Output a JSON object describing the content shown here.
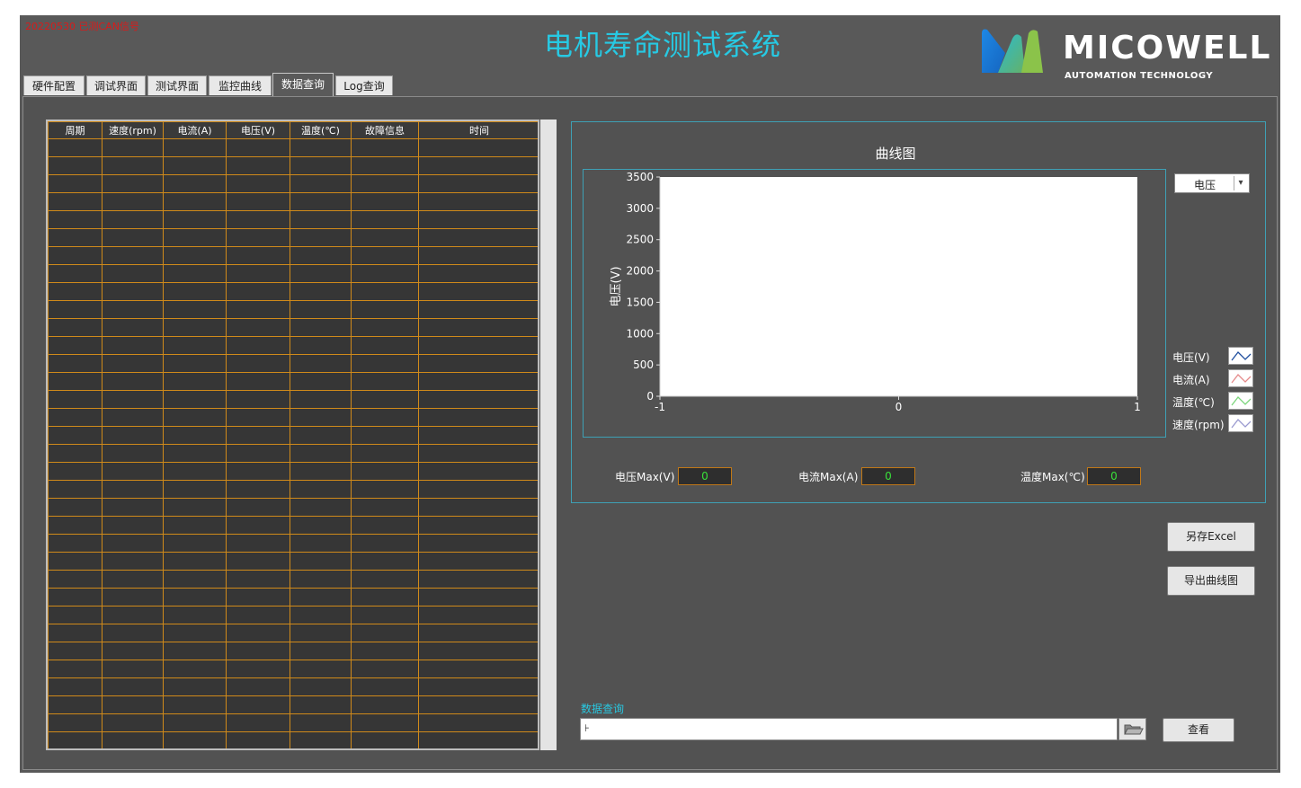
{
  "header": {
    "note": "20220530 已测CAN信号",
    "title": "电机寿命测试系统",
    "logo": {
      "name": "MICOWELL",
      "subtitle": "AUTOMATION TECHNOLOGY"
    }
  },
  "tabs": [
    {
      "label": "硬件配置",
      "active": false
    },
    {
      "label": "调试界面",
      "active": false
    },
    {
      "label": "测试界面",
      "active": false
    },
    {
      "label": "监控曲线",
      "active": false
    },
    {
      "label": "数据查询",
      "active": true
    },
    {
      "label": "Log查询",
      "active": false
    }
  ],
  "table": {
    "columns": [
      "周期",
      "速度(rpm)",
      "电流(A)",
      "电压(V)",
      "温度(℃)",
      "故障信息",
      "时间"
    ],
    "empty_rows": 34
  },
  "chart_data": {
    "type": "line",
    "title": "曲线图",
    "ylabel": "电压(V)",
    "xlim": [
      -1,
      1
    ],
    "ylim": [
      0,
      3500
    ],
    "x_ticks": [
      "-1",
      "0",
      "1"
    ],
    "y_ticks": [
      "3500",
      "3000",
      "2500",
      "2000",
      "1500",
      "1000",
      "500",
      "0"
    ],
    "series": [],
    "legend": [
      {
        "label": "电压(V)",
        "color": "#1f4e9e"
      },
      {
        "label": "电流(A)",
        "color": "#e58a8a"
      },
      {
        "label": "温度(℃)",
        "color": "#7cd67c"
      },
      {
        "label": "速度(rpm)",
        "color": "#9a9ad0"
      }
    ],
    "legend_position": "right"
  },
  "chart_controls": {
    "series_select": "电压"
  },
  "max_indicators": [
    {
      "label": "电压Max(V)",
      "value": "0"
    },
    {
      "label": "电流Max(A)",
      "value": "0"
    },
    {
      "label": "温度Max(℃)",
      "value": "0"
    }
  ],
  "buttons": {
    "save_excel": "另存Excel",
    "export_chart": "导出曲线图",
    "view": "查看"
  },
  "query": {
    "label": "数据查询",
    "path_value": ""
  },
  "colors": {
    "background": "#595959",
    "title": "#27c9e3",
    "table_grid": "#d08a1a",
    "indicator_text": "#39e03a"
  }
}
